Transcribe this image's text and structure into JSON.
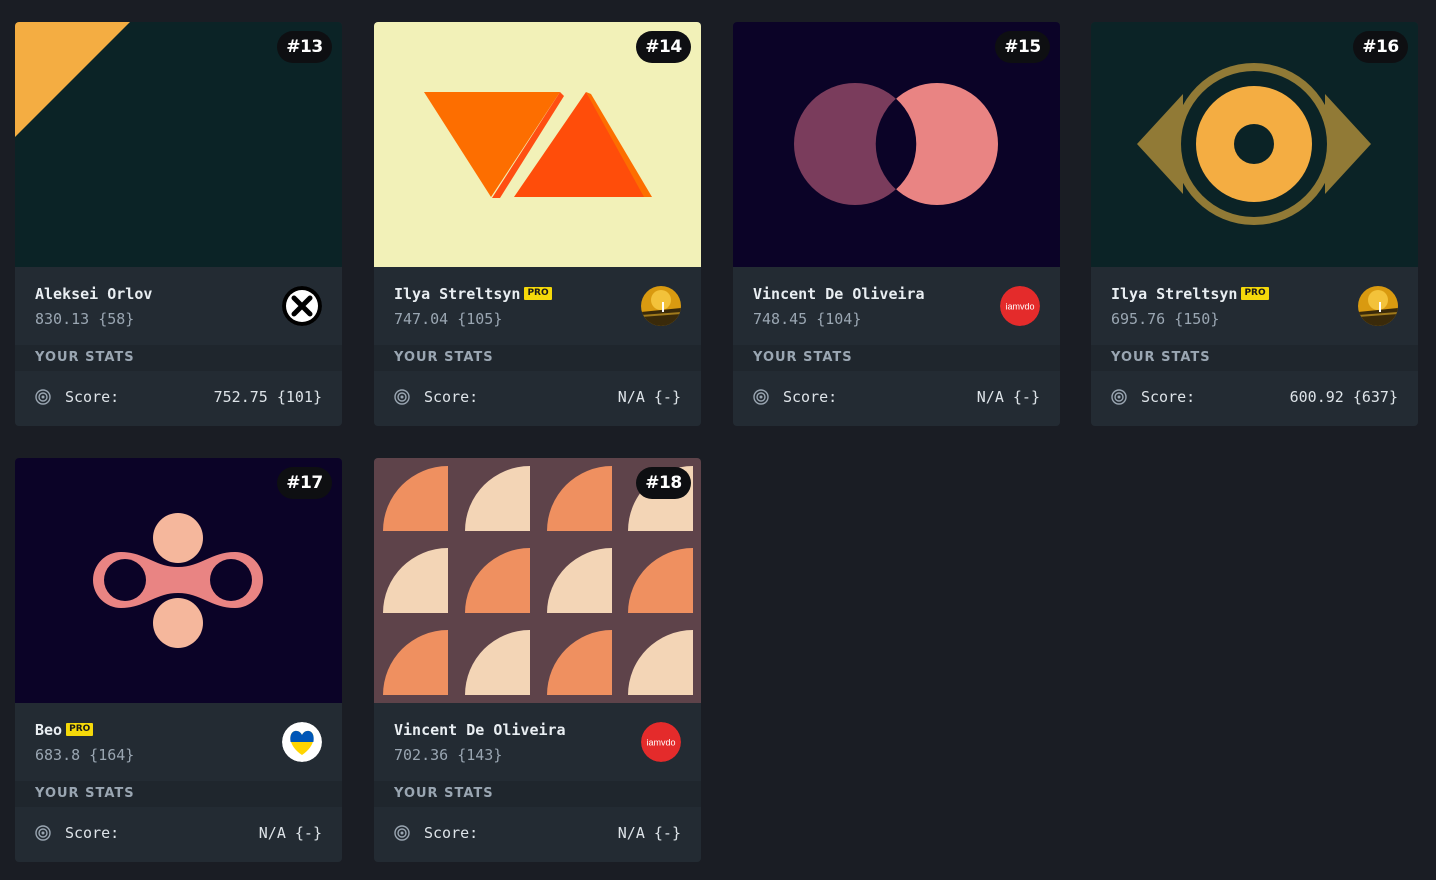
{
  "section": {
    "stats_label": "YOUR STATS",
    "score_label": "Score:"
  },
  "cards": [
    {
      "rank": "#13",
      "author": "Aleksei Orlov",
      "pro": false,
      "points": "830.13 {58}",
      "your_score": "752.75 {101}",
      "avatar_icon": "x-logo-icon"
    },
    {
      "rank": "#14",
      "author": "Ilya Streltsyn",
      "pro": true,
      "pro_label": "PRO",
      "points": "747.04 {105}",
      "your_score": "N/A {-}",
      "avatar_icon": "photo-avatar"
    },
    {
      "rank": "#15",
      "author": "Vincent De Oliveira",
      "pro": false,
      "points": "748.45 {104}",
      "your_score": "N/A {-}",
      "avatar_icon": "iamvdo-avatar",
      "avatar_text": "iamvdo"
    },
    {
      "rank": "#16",
      "author": "Ilya Streltsyn",
      "pro": true,
      "pro_label": "PRO",
      "points": "695.76 {150}",
      "your_score": "600.92 {637}",
      "avatar_icon": "photo-avatar"
    },
    {
      "rank": "#17",
      "author": "Beo",
      "pro": true,
      "pro_label": "PRO",
      "points": "683.8 {164}",
      "your_score": "N/A {-}",
      "avatar_icon": "ukraine-heart-avatar"
    },
    {
      "rank": "#18",
      "author": "Vincent De Oliveira",
      "pro": false,
      "points": "702.36 {143}",
      "your_score": "N/A {-}",
      "avatar_icon": "iamvdo-avatar",
      "avatar_text": "iamvdo"
    }
  ],
  "colors": {
    "page_bg": "#1a1d24",
    "card_bg": "#232b33",
    "pro_badge": "#f5d90a",
    "rank_badge": "#0e0f12"
  }
}
